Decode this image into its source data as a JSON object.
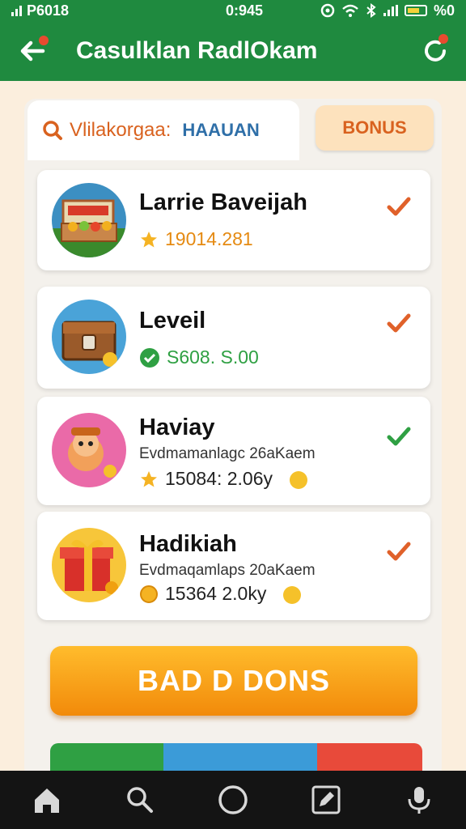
{
  "status_bar": {
    "carrier": "P6018",
    "time": "0:945",
    "battery": "%0"
  },
  "app_bar": {
    "title": "Casulklan RadlOkam"
  },
  "tabs": {
    "active_text": "Vlilakorgaa:",
    "active_highlight": "HAAUAN",
    "bonus_label": "BONUS"
  },
  "items": [
    {
      "title": "Larrie Baveijah",
      "subtitle": "",
      "value": "19014.281",
      "value_color": "#e58a12",
      "check_color": "#e0612a"
    },
    {
      "title": "Leveil",
      "subtitle": "",
      "value": "S608. S.00",
      "value_color": "#2fa043",
      "check_color": "#e0612a"
    },
    {
      "title": "Haviay",
      "subtitle": "Evdmamanlagc 26aKaem",
      "value": "15084: 2.06y",
      "value_color": "#222222",
      "check_color": "#2fa043"
    },
    {
      "title": "Hadikiah",
      "subtitle": "Evdmaqamlaps 20aKaem",
      "value": "15364 2.0ky",
      "value_color": "#222222",
      "check_color": "#e0612a"
    }
  ],
  "main_button": {
    "label": "BAD D DONS"
  },
  "colors": {
    "brand_green": "#1f8a3f",
    "accent_orange": "#f28a0a"
  },
  "nav": [
    {
      "icon": "home-icon"
    },
    {
      "icon": "search-icon"
    },
    {
      "icon": "circle-icon"
    },
    {
      "icon": "edit-icon"
    },
    {
      "icon": "mic-icon"
    }
  ]
}
